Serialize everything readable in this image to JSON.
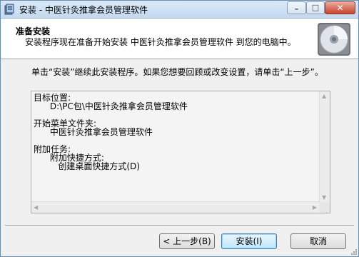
{
  "window": {
    "title": "安装 - 中医针灸推拿会员管理软件",
    "controls": {
      "minimize": "–",
      "maximize": "□",
      "close": "✕"
    }
  },
  "header": {
    "title": "准备安装",
    "subtitle": "安装程序现在准备开始安装 中医针灸推拿会员管理软件 到您的电脑中。"
  },
  "instruction": "单击“安装”继续此安装程序。如果您想要回顾或改变设置，请单击“上一步”。",
  "memo": {
    "lines": [
      "目标位置:",
      "      D:\\PC包\\中医针灸推拿会员管理软件",
      "",
      "开始菜单文件夹:",
      "      中医针灸推拿会员管理软件",
      "",
      "附加任务:",
      "      附加快捷方式:",
      "         创建桌面快捷方式(D)"
    ]
  },
  "buttons": {
    "back": "< 上一步(B)",
    "install": "安装(I)",
    "cancel": "取消"
  }
}
